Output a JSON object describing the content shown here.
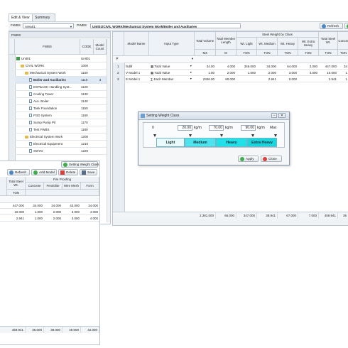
{
  "tabs": {
    "edit_view": "Edit & View",
    "summary": "Summary"
  },
  "filters": {
    "fwbs_label": "FWBS",
    "fwbs_value": "Area01",
    "pwbs_label": "PWBS",
    "pwbs_value": "Unit01/CIVIL WORK/Mechanical System Work/Boiler and Auxiliaries",
    "refresh": "Refresh"
  },
  "tree": {
    "panel_title": "FWBS",
    "col_fwbs": "FWBS",
    "col_code": "CODE",
    "col_count": "Model Count",
    "rows": [
      {
        "name": "Unit01",
        "code": "Unit01",
        "count": ""
      },
      {
        "name": "CIVIL WORK",
        "code": "1000",
        "count": ""
      },
      {
        "name": "Mechanical System Work",
        "code": "1100",
        "count": ""
      },
      {
        "name": "Boiler and Auxiliaries",
        "code": "1110",
        "count": "3"
      },
      {
        "name": "ESP&ASH Handling Syst...",
        "code": "1120",
        "count": ""
      },
      {
        "name": "Cooling Tower",
        "code": "1130",
        "count": ""
      },
      {
        "name": "Aux. Boiler",
        "code": "1140",
        "count": ""
      },
      {
        "name": "Tank Foundation",
        "code": "1150",
        "count": ""
      },
      {
        "name": "FGD System",
        "code": "1160",
        "count": ""
      },
      {
        "name": "Sump Pump Pit",
        "code": "1170",
        "count": ""
      },
      {
        "name": "Test FWBS",
        "code": "1180",
        "count": ""
      },
      {
        "name": "Electrical System Work",
        "code": "1200",
        "count": ""
      },
      {
        "name": "Electrical Equipment",
        "code": "1210",
        "count": ""
      },
      {
        "name": "SWYD",
        "code": "1220",
        "count": ""
      }
    ]
  },
  "grid": {
    "headers": {
      "model_name": "Model Name",
      "input_type": "Input Type",
      "total_volume": "Total Volume",
      "total_member_length": "Total Member Length",
      "steel_weight_by_class": "Steel Weight by Class",
      "wt_light": "Wt. Light",
      "wt_medium": "Wt. Medium",
      "wt_heavy": "Wt. Heavy",
      "wt_extra_heavy": "Wt. Extra Heavy",
      "total_steel_wt": "Total Steel Wt.",
      "concrete": "Concre",
      "unit_volume": "M3",
      "unit_length": "M",
      "unit_ton": "TON"
    },
    "rows": [
      {
        "no": "1",
        "model": "fsdlif",
        "input": "Total Value",
        "volume": "34.00",
        "length": "4.000",
        "light": "346.000",
        "medium": "34.000",
        "heavy": "64.000",
        "extra": "3.000",
        "total": "447.000",
        "concrete": "34"
      },
      {
        "no": "2",
        "model": "V Model 1",
        "input": "Total Value",
        "volume": "1.00",
        "length": "2.000",
        "light": "1.000",
        "medium": "2.000",
        "heavy": "3.000",
        "extra": "4.000",
        "total": "10.000",
        "concrete": "1"
      },
      {
        "no": "3",
        "model": "E Model 1",
        "input": "Each Member",
        "volume": "2346.00",
        "length": "60.000",
        "light": "",
        "medium": "2.941",
        "heavy": "0.000",
        "extra": "",
        "total": "2.941",
        "concrete": "1"
      }
    ],
    "totals": {
      "volume": "2,381.000",
      "length": "66.000",
      "light": "347.000",
      "medium": "38.941",
      "heavy": "67.000",
      "extra": "7.000",
      "total": "459.941",
      "concrete": "36"
    }
  },
  "left_overlay": {
    "setting_weight_class": "Setting Weight Class",
    "refresh": "Refresh",
    "add_model": "Add Model",
    "delete": "Delete",
    "save": "Save",
    "fire_proofing": "Fire Proofing",
    "col_total_steel": "Total Steel Wt.",
    "col_concrete": "Concrete",
    "col_fendolite": "Fendolite",
    "col_wire_mesh": "Wire Mesh",
    "col_form": "Form",
    "unit_ton": "TON",
    "rows": [
      [
        "447.000",
        "34.000",
        "34.000",
        "43.000",
        "34.000"
      ],
      [
        "10.000",
        "1.000",
        "2.000",
        "3.000",
        "4.000"
      ],
      [
        "2.941",
        "1.000",
        "2.000",
        "3.000",
        "4.000"
      ]
    ],
    "totals": [
      "459.941",
      "36.000",
      "38.000",
      "49.000",
      "42.000"
    ]
  },
  "dialog": {
    "title": "Setting Weight Class",
    "min_label": "0",
    "max_label": "Max",
    "thresholds": [
      "20.00",
      "70.00",
      "90.00"
    ],
    "unit": "kg/m",
    "classes": [
      "Light",
      "Medium",
      "Heavy",
      "Extra Heavy"
    ],
    "class_colors": [
      "#eaf9fb",
      "#4ee4ee",
      "#22e0e8",
      "#18d6dd"
    ],
    "apply": "Apply",
    "close": "Close"
  }
}
